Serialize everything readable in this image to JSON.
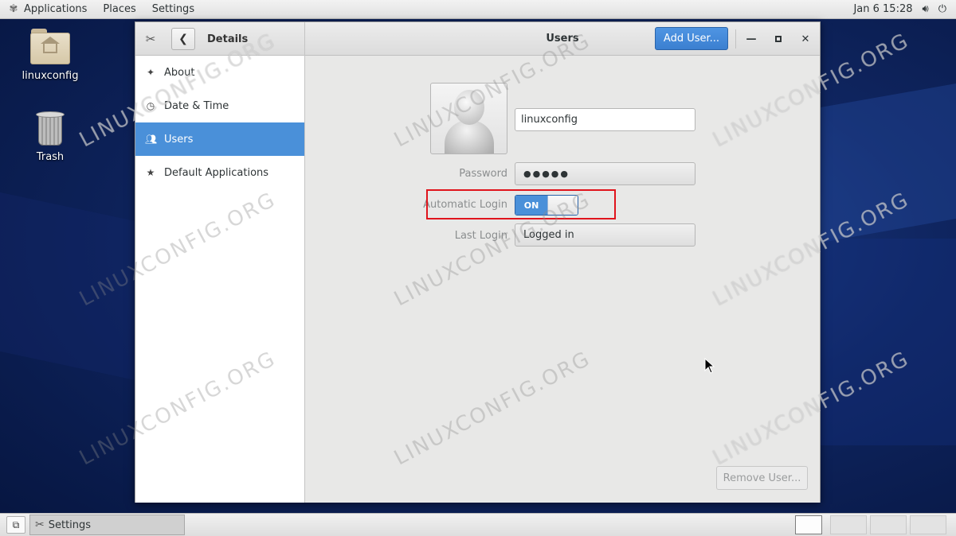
{
  "topbar": {
    "applications": "Applications",
    "places": "Places",
    "settings": "Settings",
    "datetime": "Jan 6  15:28"
  },
  "desktop": {
    "icons": [
      {
        "label": "linuxconfig",
        "icon": "home-folder-icon"
      },
      {
        "label": "Trash",
        "icon": "trash-icon"
      }
    ]
  },
  "window": {
    "sidebar_title": "Details",
    "title": "Users",
    "add_user_label": "Add User...",
    "sidebar_items": [
      {
        "label": "About",
        "icon": "sparkle-icon"
      },
      {
        "label": "Date & Time",
        "icon": "clock-icon"
      },
      {
        "label": "Users",
        "icon": "users-icon",
        "active": true
      },
      {
        "label": "Default Applications",
        "icon": "star-icon"
      }
    ],
    "user": {
      "name": "linuxconfig",
      "password_label": "Password",
      "password_value": "●●●●●",
      "auto_login_label": "Automatic Login",
      "auto_login_state": "ON",
      "last_login_label": "Last Login",
      "last_login_value": "Logged in"
    },
    "remove_user_label": "Remove User..."
  },
  "watermark": "LINUXCONFIG.ORG",
  "taskbar": {
    "task_label": "Settings"
  },
  "colors": {
    "accent": "#4a90d9",
    "highlight": "#e0141c"
  }
}
